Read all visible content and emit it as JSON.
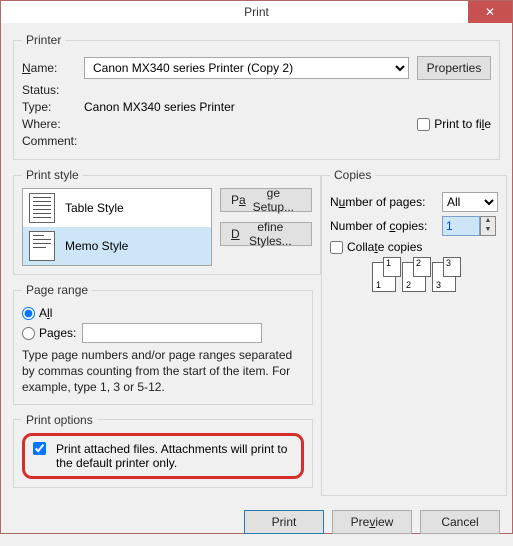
{
  "title": "Print",
  "close_tooltip": "Close",
  "printer": {
    "legend": "Printer",
    "name_label": "Name:",
    "selected": "Canon MX340 series Printer (Copy 2)",
    "properties_label": "Properties",
    "status_label": "Status:",
    "status_value": "",
    "type_label": "Type:",
    "type_value": "Canon MX340 series Printer",
    "where_label": "Where:",
    "where_value": "",
    "comment_label": "Comment:",
    "comment_value": "",
    "print_to_file_label": "Print to file",
    "print_to_file_checked": false
  },
  "print_style": {
    "legend": "Print style",
    "items": [
      {
        "label": "Table Style",
        "selected": false
      },
      {
        "label": "Memo Style",
        "selected": true
      }
    ],
    "page_setup_label": "Page Setup...",
    "define_styles_label": "Define Styles..."
  },
  "copies": {
    "legend": "Copies",
    "num_pages_label": "Number of pages:",
    "num_pages_value": "All",
    "num_copies_label": "Number of copies:",
    "num_copies_value": "1",
    "collate_label": "Collate copies",
    "collate_checked": false
  },
  "page_range": {
    "legend": "Page range",
    "all_label": "All",
    "all_selected": true,
    "pages_label": "Pages:",
    "pages_value": "",
    "hint": "Type page numbers and/or page ranges separated by commas counting from the start of the item.  For example, type 1, 3 or 5-12."
  },
  "print_options": {
    "legend": "Print options",
    "attached_label": "Print attached files.  Attachments will print to the default printer only.",
    "attached_checked": true
  },
  "buttons": {
    "print": "Print",
    "preview": "Preview",
    "cancel": "Cancel"
  }
}
